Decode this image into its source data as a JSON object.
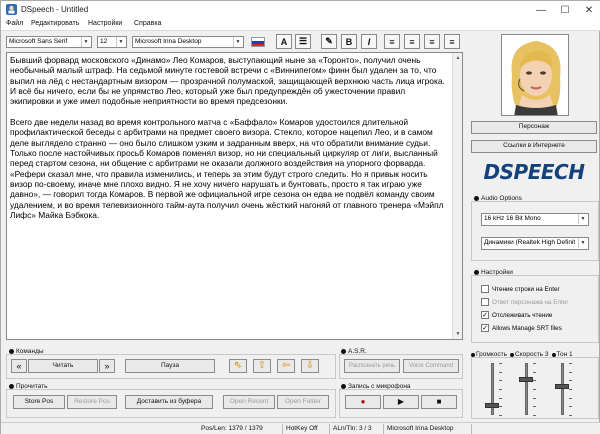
{
  "window": {
    "title": "DSpeech - Untitled",
    "minimize": "—",
    "maximize": "☐",
    "close": "✕"
  },
  "menu": [
    "Файл",
    "Редактировать",
    "Настройки",
    "Справка"
  ],
  "toolbar": {
    "font": "Microsoft Sans Serif",
    "size": "12",
    "voice": "Microsoft Irina Desktop",
    "format_buttons": [
      "A",
      "☰",
      "✎",
      "B",
      "I",
      "≡",
      "≡",
      "≡",
      "≡"
    ]
  },
  "editor": {
    "text": "Бывший форвард московского «Динамо» Лео Комаров, выступающий ныне за «Торонто», получил очень необычный малый штраф. На седьмой минуте гостевой встречи с «Виннипегом» финн был удален за то, что выпил на лёд с нестандартным визором — прозрачной полумаской, защищающей верхнюю часть лица игрока. И всё бы ничего, если бы не упрямство Лео, который уже был предупреждён об ужесточении правил экипировки и уже имел подобные неприятности во время предсезонки.\n\nВсего две недели назад во время контрольного матча с «Баффало» Комаров удостоился длительной профилактической беседы с арбитрами на предмет своего визора. Стекло, которое нацепил Лео, и в самом деле выглядело странно — оно было слишком узким и задранным вверх, на что обратили внимание судьи. Только после настойчивых просьб Комаров поменял визор, но ни специальный циркуляр от лиги, высланный перед стартом сезона, ни общение с арбитрами не оказали должного воздействия на упорного форварда. «Рефери сказал мне, что правила изменились, и теперь за этим будут строго следить. Но я привык носить визор по-своему, иначе мне плохо видно. Я не хочу ничего нарушать и бунтовать, просто я так играю уже давно», — говорил тогда Комаров. В первой же официальной игре сезона он едва не подвёл команду своим удалением, и во время телевизионного тайм-аута получил очень жёсткий нагоняй от главного тренера «Мэйпл Лифс» Майка Бэбкока."
  },
  "right": {
    "persona_button": "Персонаж",
    "links_button": "Ссылки в Интернете",
    "logo_text": "DSPEECH",
    "audio_options_label": "Audio Options",
    "audio_format": "16 kHz 16 Bit Mono",
    "audio_device": "Динамики (Realtek High Definit",
    "settings_label": "Настройки",
    "settings": [
      {
        "label": "Чтение строки на Enter",
        "checked": false,
        "disabled": false
      },
      {
        "label": "Ответ персонажа на Enter",
        "checked": false,
        "disabled": true
      },
      {
        "label": "Отслеживать чтение",
        "checked": true,
        "disabled": false
      },
      {
        "label": "Allows Manage SRT files",
        "checked": true,
        "disabled": false
      }
    ],
    "sliders_labels": [
      "Громкость",
      "Скорость 3",
      "Тон 1"
    ],
    "sliders": [
      0.15,
      0.7,
      0.55
    ]
  },
  "commands": {
    "label": "Команды",
    "prev": "«",
    "read": "Читать",
    "next": "»",
    "pause": "Пауза",
    "arrows": [
      "⇖",
      "⇧",
      "⇦",
      "⇩"
    ],
    "asr_label": "A.S.R.",
    "asr_buttons": [
      "Распознать речь",
      "Voice Command"
    ]
  },
  "read_panel": {
    "label": "Прочитать",
    "store_pos": "Store Pos",
    "restore_pos": "Restore Pos",
    "read_clipboard": "Доставить из буфера",
    "open_recent": "Open Recent",
    "open_folder": "Open Folder"
  },
  "record": {
    "label": "Запись с микрофона",
    "buttons": [
      "●",
      "▶",
      "■"
    ]
  },
  "status": {
    "poslen": "Pos/Len: 1379 / 1379",
    "hotkey": "HotKey Off",
    "aln": "ALn/Tln: 3 / 3",
    "voice": "Microsoft Irina Desktop"
  }
}
